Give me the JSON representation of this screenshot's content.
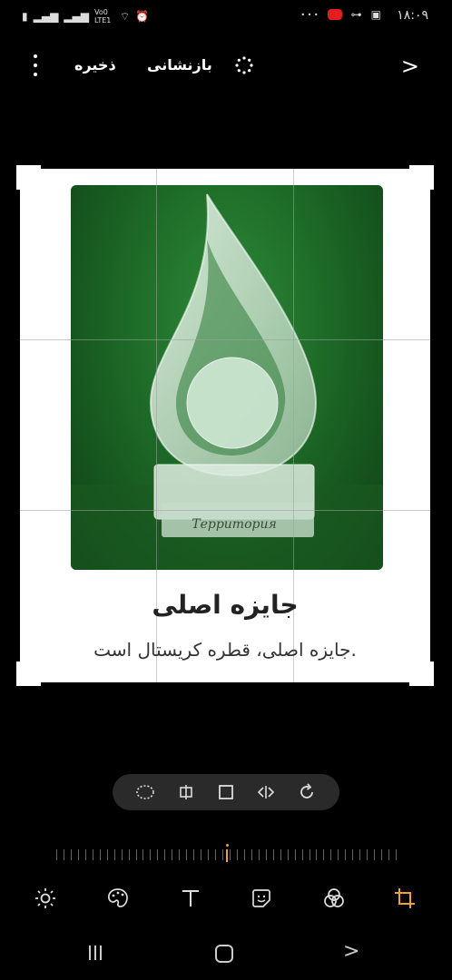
{
  "status_bar": {
    "time": "۱۸:۰۹",
    "network_label": "Vo0 LTE1",
    "more_dots": "• • •"
  },
  "toolbar": {
    "save_label": "ذخیره",
    "revert_label": "بازنشانی"
  },
  "canvas": {
    "caption_title": "جایزه اصلی",
    "caption_subtitle": "جایزه اصلی، قطره کریستال است.",
    "engraving": "Территория"
  },
  "colors": {
    "accent": "#f0a030",
    "background": "#000000",
    "pill": "#2a2a2a"
  },
  "crop_tools": [
    "lasso-icon",
    "flip-icon",
    "free-crop-icon",
    "mirror-icon",
    "rotate-icon"
  ],
  "bottom_tools": [
    "brightness-icon",
    "palette-icon",
    "text-icon",
    "sticker-icon",
    "filter-icon",
    "crop-icon"
  ],
  "slider": {
    "value": 0.5
  }
}
